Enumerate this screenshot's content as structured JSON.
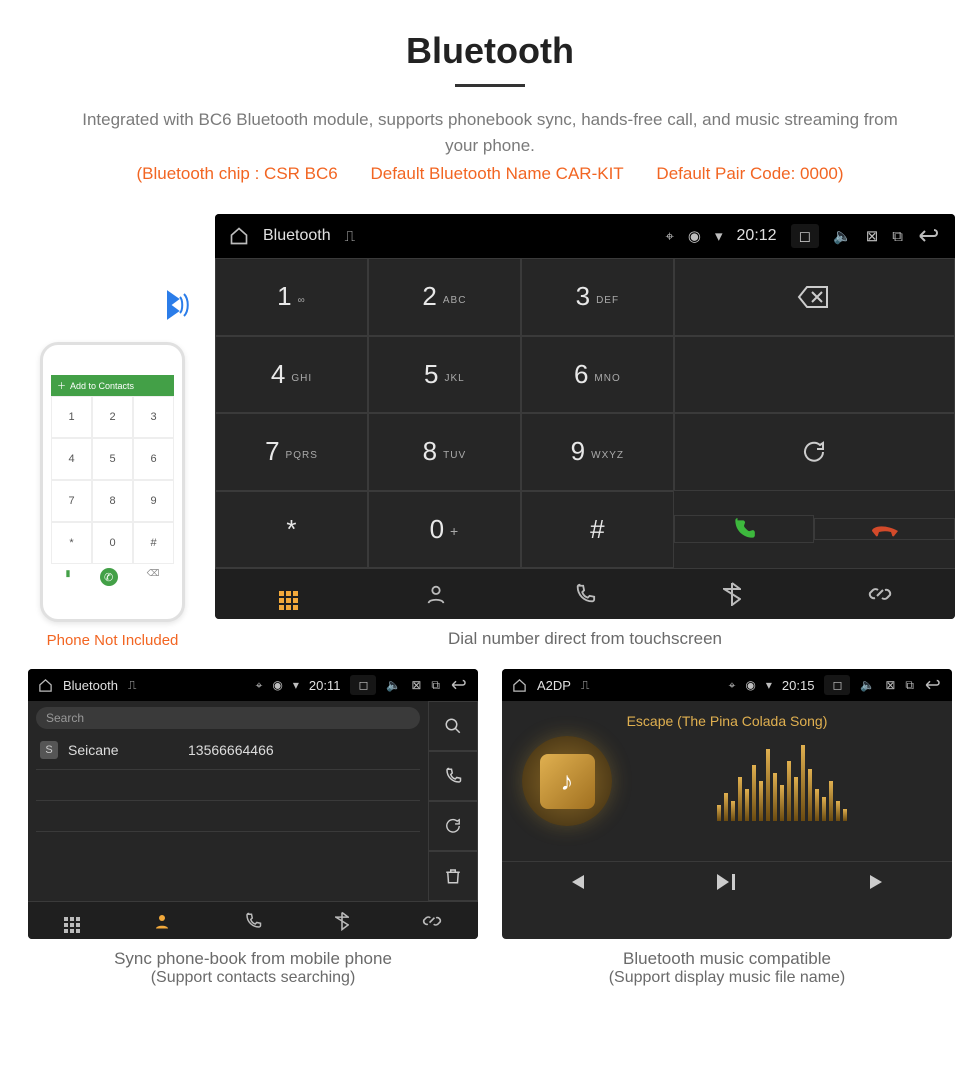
{
  "header": {
    "title": "Bluetooth",
    "description": "Integrated with BC6 Bluetooth module, supports phonebook sync, hands-free call, and music streaming from your phone.",
    "spec_chip": "(Bluetooth chip : CSR BC6",
    "spec_name": "Default Bluetooth Name CAR-KIT",
    "spec_code": "Default Pair Code: 0000)"
  },
  "phone": {
    "not_included": "Phone Not Included",
    "add_contacts": "Add to Contacts",
    "keys": [
      "1",
      "2",
      "3",
      "4",
      "5",
      "6",
      "7",
      "8",
      "9",
      "*",
      "0",
      "#"
    ]
  },
  "dialer": {
    "statusbar": {
      "title": "Bluetooth",
      "time": "20:12"
    },
    "keys": [
      {
        "n": "1",
        "s": "∞"
      },
      {
        "n": "2",
        "s": "ABC"
      },
      {
        "n": "3",
        "s": "DEF"
      },
      {
        "n": "4",
        "s": "GHI"
      },
      {
        "n": "5",
        "s": "JKL"
      },
      {
        "n": "6",
        "s": "MNO"
      },
      {
        "n": "7",
        "s": "PQRS"
      },
      {
        "n": "8",
        "s": "TUV"
      },
      {
        "n": "9",
        "s": "WXYZ"
      },
      {
        "n": "*",
        "s": ""
      },
      {
        "n": "0",
        "s": "+"
      },
      {
        "n": "#",
        "s": ""
      }
    ]
  },
  "captions": {
    "dialer": "Dial number direct from touchscreen",
    "phonebook_l1": "Sync phone-book from mobile phone",
    "phonebook_l2": "(Support contacts searching)",
    "music_l1": "Bluetooth music compatible",
    "music_l2": "(Support display music file name)"
  },
  "phonebook": {
    "statusbar": {
      "title": "Bluetooth",
      "time": "20:11"
    },
    "search_placeholder": "Search",
    "contact_badge": "S",
    "contact_name": "Seicane",
    "contact_number": "13566664466"
  },
  "music": {
    "statusbar": {
      "title": "A2DP",
      "time": "20:15"
    },
    "track": "Escape (The Pina Colada Song)"
  }
}
